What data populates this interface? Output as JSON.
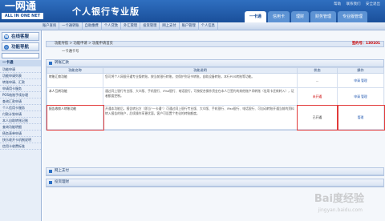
{
  "header": {
    "logo_main": "一网通",
    "logo_sub": "ALL IN ONE NET",
    "title": "个人银行专业版",
    "top_links": [
      "帮助",
      "联系我们",
      "安全退出"
    ],
    "tabs": [
      "一卡通",
      "信用卡",
      "理财",
      "财务管理",
      "专业版管理"
    ]
  },
  "menu": [
    "账户查询",
    "一卡通转账",
    "自助缴费",
    "个人贷款",
    "外汇管理",
    "投资管理",
    "网上支付",
    "账户管理",
    "个人信息"
  ],
  "sidebar": {
    "online_service": "在线客服",
    "nav_title": "功能导航",
    "search_value": "",
    "category": "一卡通",
    "items": [
      "功能申请",
      "功能申请列表",
      "转账申请、汇款",
      "申请用卡服务",
      "POS结账手续办理",
      "查询汇款申请",
      "个人信用卡服务",
      "付款计划申请",
      "本人自助转账记账",
      "查询功能明细",
      "债务表单申请",
      "快乐收开卡机制说明",
      "信用卡收费标准"
    ]
  },
  "breadcrumb": {
    "text": "功能导航 > 功能申请 > 功能申请首页",
    "right_label": "签约号：",
    "right_value": "130101"
  },
  "card": {
    "label": "一卡通卡号"
  },
  "sections": {
    "transfer": {
      "title": "转账汇款",
      "headers": [
        "功能名称",
        "功能说明",
        "状态",
        "操作"
      ],
      "rows": [
        {
          "name": "转账汇款功能",
          "desc": "您可将个人网银开通专业版转账，按当前银行转账，仅保护到证书转账，自助设备转账，本行POS转账等功能。",
          "status": "--",
          "ops": [
            "申请",
            "管理"
          ]
        },
        {
          "name": "本人互转功能",
          "desc": "通过同上银行专业版、大众版、手机银行、iPad银行、电话银行，可按权合操作资金在本人已签约的其他账户间转账（信用卡还款转入），证者额度控制。",
          "status": "未开通",
          "ops": [
            "申请",
            "管理"
          ]
        },
        {
          "name": "报告收款人转账功能",
          "desc": "开通本功能后，报告转出方（即当“一卡通”）可通过同上银行专业版、大众版、手机银行、iPad银行、电话银行、可自动转账开通当前的资料转入报告的账户，后续操作享更优惠，客户可设置个性化的转账额度。",
          "status": "已开通",
          "ops": [
            "管理"
          ]
        }
      ]
    },
    "online_pay": {
      "title": "网上支付"
    },
    "invest": {
      "title": "投资理财"
    }
  },
  "watermark": {
    "text": "Bai度经验",
    "url": "jingyan.baidu.com"
  },
  "colors": {
    "header_blue": "#1a4f9a",
    "link_blue": "#1f56b0",
    "highlight_red": "#e23b3b"
  }
}
